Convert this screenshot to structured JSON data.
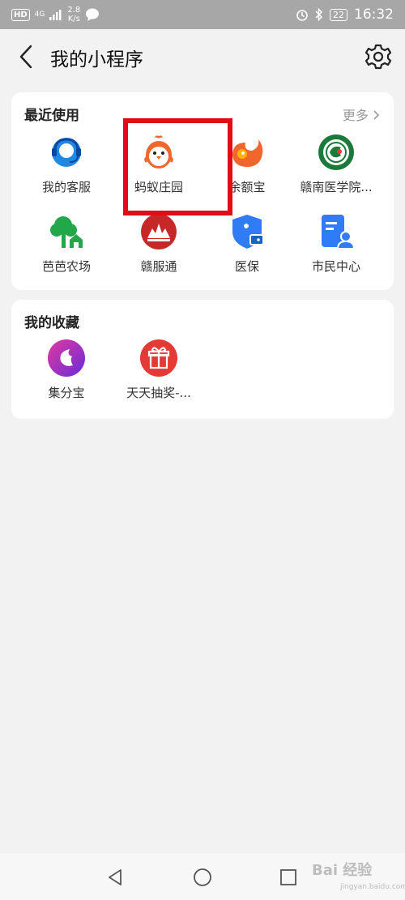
{
  "status_bar": {
    "hd": "HD",
    "network": "4G",
    "speed_value": "2.8",
    "speed_unit": "K/s",
    "battery": "22",
    "time": "16:32"
  },
  "header": {
    "title": "我的小程序"
  },
  "recent": {
    "title": "最近使用",
    "more_label": "更多",
    "apps": [
      {
        "label": "我的客服",
        "icon": "customer-service-icon"
      },
      {
        "label": "蚂蚁庄园",
        "icon": "chick-icon"
      },
      {
        "label": "余额宝",
        "icon": "yuebao-icon"
      },
      {
        "label": "赣南医学院...",
        "icon": "college-emblem-icon"
      },
      {
        "label": "芭芭农场",
        "icon": "tree-farm-icon"
      },
      {
        "label": "赣服通",
        "icon": "ganfutong-icon"
      },
      {
        "label": "医保",
        "icon": "medical-insurance-icon"
      },
      {
        "label": "市民中心",
        "icon": "citizen-center-icon"
      }
    ]
  },
  "favorites": {
    "title": "我的收藏",
    "apps": [
      {
        "label": "集分宝",
        "icon": "jifenbao-icon"
      },
      {
        "label": "天天抽奖-...",
        "icon": "gift-icon"
      }
    ]
  },
  "watermark": {
    "text": "Bai 经验",
    "sub": "jingyan.baidu.com"
  },
  "colors": {
    "highlight": "#e30b17",
    "accent_orange": "#f0662b",
    "accent_blue": "#2f7cf6"
  }
}
